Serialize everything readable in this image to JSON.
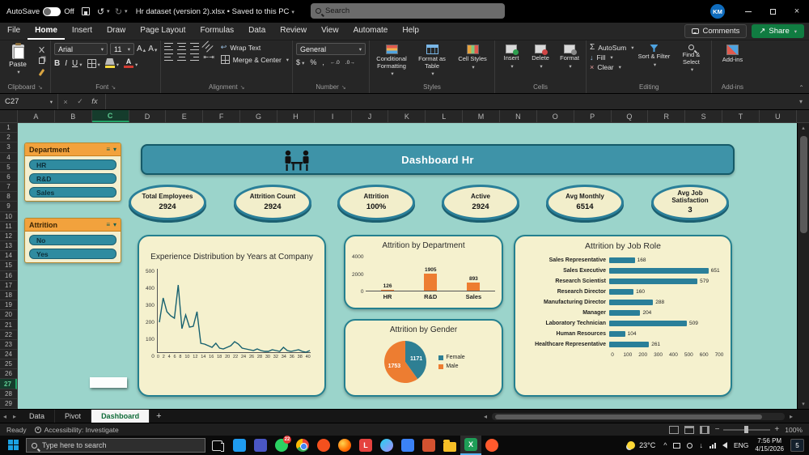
{
  "titlebar": {
    "autosave_label": "AutoSave",
    "autosave_state": "Off",
    "doc_title": "Hr dataset (version 2).xlsx • Saved to this PC",
    "search_placeholder": "Search",
    "avatar": "KM"
  },
  "ribbon": {
    "tabs": [
      "File",
      "Home",
      "Insert",
      "Draw",
      "Page Layout",
      "Formulas",
      "Data",
      "Review",
      "View",
      "Automate",
      "Help"
    ],
    "active_tab": "Home",
    "comments": "Comments",
    "share": "Share",
    "paste": "Paste",
    "font_name": "Arial",
    "font_size": "11",
    "wrap_text": "Wrap Text",
    "merge_center": "Merge & Center",
    "number_format": "General",
    "conditional_formatting": "Conditional Formatting",
    "format_as_table": "Format as Table",
    "cell_styles": "Cell Styles",
    "insert": "Insert",
    "delete": "Delete",
    "format": "Format",
    "autosum": "AutoSum",
    "fill": "Fill",
    "clear": "Clear",
    "sort_filter": "Sort & Filter",
    "find_select": "Find & Select",
    "addins": "Add-ins",
    "groups": {
      "clipboard": "Clipboard",
      "font": "Font",
      "alignment": "Alignment",
      "number": "Number",
      "styles": "Styles",
      "cells": "Cells",
      "editing": "Editing",
      "addins": "Add-ins"
    }
  },
  "formula_bar": {
    "name_box": "C27",
    "fx_label": "fx"
  },
  "grid": {
    "columns": [
      "A",
      "B",
      "C",
      "D",
      "E",
      "F",
      "G",
      "H",
      "I",
      "J",
      "K",
      "L",
      "M",
      "N",
      "O",
      "P",
      "Q",
      "R",
      "S",
      "T",
      "U"
    ],
    "row_count": 29,
    "selected_col": "C",
    "selected_row": 27
  },
  "dashboard": {
    "title": "Dashboard Hr",
    "slicers": [
      {
        "title": "Department",
        "items": [
          "HR",
          "R&D",
          "Sales"
        ]
      },
      {
        "title": "Attrition",
        "items": [
          "No",
          "Yes"
        ]
      }
    ],
    "kpis": [
      {
        "label": "Total Employees",
        "value": "2924"
      },
      {
        "label": "Attrition Count",
        "value": "2924"
      },
      {
        "label": "Attrition",
        "value": "100%"
      },
      {
        "label": "Active",
        "value": "2924"
      },
      {
        "label": "Avg Monthly",
        "value": "6514"
      },
      {
        "label": "Avg Job Satisfaction",
        "value": "3"
      }
    ]
  },
  "chart_data": [
    {
      "type": "line",
      "title": "Experience Distribution by Years at Company",
      "x_ticks": [
        0,
        2,
        4,
        6,
        8,
        10,
        12,
        14,
        16,
        18,
        20,
        22,
        24,
        26,
        28,
        30,
        32,
        34,
        36,
        38,
        40
      ],
      "x_range": [
        0,
        40
      ],
      "values": [
        190,
        340,
        255,
        230,
        215,
        420,
        150,
        235,
        160,
        165,
        255,
        60,
        55,
        45,
        35,
        60,
        30,
        25,
        35,
        45,
        70,
        55,
        30,
        25,
        20,
        15,
        25,
        15,
        10,
        10,
        20,
        15,
        10,
        35,
        15,
        10,
        15,
        20,
        10,
        5,
        15
      ],
      "ylim": [
        0,
        500
      ],
      "y_ticks": [
        0,
        100,
        200,
        300,
        400,
        500
      ],
      "line_color": "#17616f"
    },
    {
      "type": "bar",
      "title": "Attrition by Department",
      "categories": [
        "HR",
        "R&D",
        "Sales"
      ],
      "values": [
        126,
        1905,
        893
      ],
      "ylim": [
        0,
        4000
      ],
      "y_ticks": [
        0,
        2000,
        4000
      ],
      "bar_color": "#ed7d31"
    },
    {
      "type": "pie",
      "title": "Attrition by Gender",
      "slices": [
        {
          "label": "Female",
          "value": 1171,
          "color": "#2e7f93"
        },
        {
          "label": "Male",
          "value": 1753,
          "color": "#ed7d31"
        }
      ],
      "legend_position": "right"
    },
    {
      "type": "hbar",
      "title": "Attrition by Job Role",
      "categories": [
        "Sales Representative",
        "Sales Executive",
        "Research Scientist",
        "Research Director",
        "Manufacturing Director",
        "Manager",
        "Laboratory Technician",
        "Human Resources",
        "Healthcare Representative"
      ],
      "values": [
        168,
        651,
        579,
        160,
        288,
        204,
        509,
        104,
        261
      ],
      "xlim": [
        0,
        700
      ],
      "x_ticks": [
        0,
        100,
        200,
        300,
        400,
        500,
        600,
        700
      ],
      "bar_color": "#2a7f99"
    }
  ],
  "sheet_tabs": {
    "tabs": [
      "Data",
      "Pivot",
      "Dashboard"
    ],
    "active": "Dashboard"
  },
  "status_bar": {
    "ready": "Ready",
    "accessibility": "Accessibility: Investigate",
    "zoom": "100%"
  },
  "taskbar": {
    "search_placeholder": "Type here to search",
    "weather_temp": "23°C",
    "language": "ENG",
    "time": "7:56 PM",
    "date": "4/15/2026",
    "notification_count": "5",
    "apps": [
      {
        "name": "code-app",
        "shape": "square",
        "color": "#1f9cf0"
      },
      {
        "name": "teams-app",
        "shape": "square",
        "color": "#4a56c4"
      },
      {
        "name": "whatsapp",
        "shape": "circle",
        "color": "#2bd162",
        "badge": "22"
      },
      {
        "name": "chrome",
        "shape": "chrome"
      },
      {
        "name": "brave",
        "shape": "circle",
        "color": "#f4501e"
      },
      {
        "name": "firefox",
        "shape": "firefox"
      },
      {
        "name": "l-app",
        "shape": "square",
        "color": "#e5423e",
        "glyph": "L"
      },
      {
        "name": "android-studio",
        "shape": "gradient"
      },
      {
        "name": "dev-app",
        "shape": "square",
        "color": "#3b82f6"
      },
      {
        "name": "mail-app",
        "shape": "square",
        "color": "#d35230"
      },
      {
        "name": "folder",
        "shape": "folder"
      },
      {
        "name": "excel",
        "shape": "square",
        "color": "#1e9e57",
        "glyph": "X",
        "active": true
      },
      {
        "name": "browser-app",
        "shape": "circle",
        "color": "#ff5a2d"
      }
    ]
  }
}
